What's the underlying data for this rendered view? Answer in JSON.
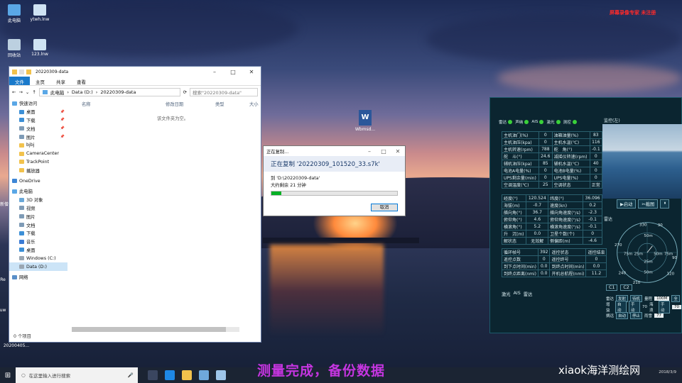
{
  "desktop": {
    "icons": [
      {
        "label": "此电脑"
      },
      {
        "label": "ytwh.lnw"
      },
      {
        "label": "回收站"
      },
      {
        "label": "123.lnw"
      }
    ],
    "side_labels": [
      "新僧",
      "Re",
      "uw",
      "20200405..."
    ],
    "overlay_text": "屏幕录像专家 未注册",
    "word_file": "Wbmsd..."
  },
  "explorer": {
    "title_path": "20220309-data",
    "ribbon": [
      "文件",
      "主页",
      "共享",
      "查看"
    ],
    "breadcrumb": [
      "此电脑",
      "Data (D:)",
      "20220309-data"
    ],
    "search_placeholder": "搜索\"20220309-data\"",
    "nav": [
      {
        "label": "快速访问",
        "level": "top"
      },
      {
        "label": "桌面",
        "pin": "📌"
      },
      {
        "label": "下载",
        "pin": "📌"
      },
      {
        "label": "文档",
        "pin": "📌"
      },
      {
        "label": "图片",
        "pin": "📌"
      },
      {
        "label": "bjbj"
      },
      {
        "label": "CameraCenter"
      },
      {
        "label": "TrackPoint"
      },
      {
        "label": "播放器"
      },
      {
        "label": "OneDrive",
        "level": "top"
      },
      {
        "label": "此电脑",
        "level": "top"
      },
      {
        "label": "3D 对象"
      },
      {
        "label": "视频"
      },
      {
        "label": "图片"
      },
      {
        "label": "文档"
      },
      {
        "label": "下载"
      },
      {
        "label": "音乐"
      },
      {
        "label": "桌面"
      },
      {
        "label": "Windows (C:)"
      },
      {
        "label": "Data (D:)",
        "selected": true
      },
      {
        "label": "网络",
        "level": "top"
      }
    ],
    "columns": [
      "名称",
      "修改日期",
      "类型",
      "大小"
    ],
    "empty_message": "该文件夹为空。",
    "status": "0 个项目"
  },
  "copy_dialog": {
    "title": "正在复制...",
    "banner": "正在复制 '20220309_101520_33.s7k'",
    "dest": "到 'D:\\20220309-data'",
    "remaining": "大约剩余 21 分钟",
    "progress": 0.08,
    "cancel_label": "取消"
  },
  "marine": {
    "status_items": [
      "雷达",
      "声纳",
      "AIS",
      "激光",
      "测控"
    ],
    "table1": [
      [
        "主机油门(%)",
        "0",
        "油箱油量(%)",
        "83"
      ],
      [
        "主机油压(kpa)",
        "0",
        "主机水温(℃)",
        "116"
      ],
      [
        "主机转速(rpm)",
        "788",
        "舵　角(°)",
        "-0.1"
      ],
      [
        "舵　斗(°)",
        "24.6",
        "减摇仪转速(rpm)",
        "0"
      ],
      [
        "辅机油压(kpa)",
        "85",
        "辅机水温(℃)",
        "40"
      ],
      [
        "电池A电量(%)",
        "0",
        "电池B电量(%)",
        "0"
      ],
      [
        "UPS剩余量(min)",
        "0",
        "UPS电量(%)",
        "0"
      ],
      [
        "空调温度(℃)",
        "25",
        "空调状态",
        "正常"
      ]
    ],
    "table2": [
      [
        "经度(°)",
        "120.524",
        "纬度(°)",
        "36.096"
      ],
      [
        "海拔(m)",
        "-0.7",
        "速度(kn)",
        "0.2"
      ],
      [
        "艏向角(°)",
        "36.7",
        "艏向角速度(°/s)",
        "-2.3"
      ],
      [
        "俯仰角(°)",
        "4.6",
        "俯仰角速度(°/s)",
        "-0.1"
      ],
      [
        "横滚角(°)",
        "5.2",
        "横滚角速度(°/s)",
        "-0.1"
      ],
      [
        "升　沉(m)",
        "0.0",
        "卫星个数(个)",
        "0"
      ],
      [
        "解状态",
        "无效解",
        "侧偏距(m)",
        "-4.6"
      ]
    ],
    "table3": [
      [
        "循环帧号",
        "392",
        "遥控状态",
        "遥控结束"
      ],
      [
        "遥控点数",
        "0",
        "遥控终号",
        "0"
      ],
      [
        "到下点时间(min)",
        "0.0",
        "到终点时间(min)",
        "0.0"
      ],
      [
        "到终点距离(nmi)",
        "0.0",
        "开机总航程(nmi)",
        "11.2"
      ]
    ],
    "tabs": [
      "激光",
      "AIS",
      "雷达"
    ],
    "camera_title": "监控(左)",
    "camera_buttons": [
      "▶启动",
      "✂截图",
      "⏸"
    ],
    "radar_title": "雷达",
    "radar_rings": [
      "50m",
      "75m",
      "25m",
      "50m",
      "75m",
      "25m",
      "50m"
    ],
    "radar_bearings": [
      "330",
      "30",
      "270",
      "90",
      "240",
      "210",
      "120"
    ],
    "radar_tabs": [
      "C1",
      "C2"
    ],
    "radar_controls": [
      [
        "雷达",
        "发射",
        "待机",
        "量程",
        "100M",
        "全"
      ],
      [
        "增益",
        "自动",
        "手动",
        "70",
        "海浪",
        "手动",
        "70"
      ],
      [
        "搁远",
        "自动",
        "停止",
        "",
        "雨雪",
        "77"
      ]
    ]
  },
  "taskbar": {
    "search_placeholder": "在这里输入进行搜索",
    "time": "2018/3/9"
  },
  "subtitle": "测量完成，备份数据",
  "watermark": "xiaok海洋测绘网"
}
